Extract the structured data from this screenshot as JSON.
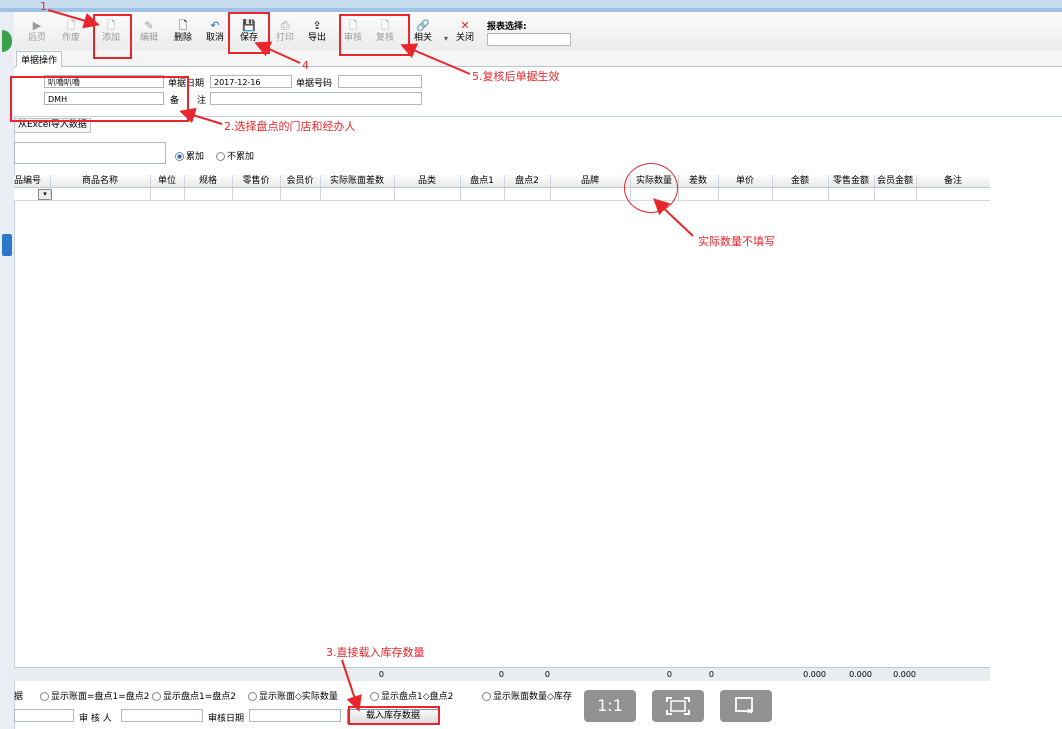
{
  "toolbar": {
    "buttons": [
      {
        "label": "后页",
        "icon": "play-icon",
        "enabled": false
      },
      {
        "label": "作废",
        "icon": "void-doc-icon",
        "enabled": false
      },
      {
        "label": "添加",
        "icon": "add-doc-icon",
        "enabled": false
      },
      {
        "label": "编辑",
        "icon": "edit-doc-icon",
        "enabled": false
      },
      {
        "label": "删除",
        "icon": "delete-doc-icon",
        "enabled": true
      },
      {
        "label": "取消",
        "icon": "undo-icon",
        "enabled": true
      },
      {
        "label": "保存",
        "icon": "save-icon",
        "enabled": true
      },
      {
        "label": "打印",
        "icon": "print-icon",
        "enabled": false
      },
      {
        "label": "导出",
        "icon": "export-icon",
        "enabled": true
      },
      {
        "label": "审核",
        "icon": "approve-icon",
        "enabled": false
      },
      {
        "label": "复核",
        "icon": "recheck-icon",
        "enabled": false
      },
      {
        "label": "相关",
        "icon": "link-icon",
        "enabled": true
      },
      {
        "label": "关闭",
        "icon": "close-icon",
        "enabled": true
      }
    ],
    "report_label": "报表选择:"
  },
  "tab": "单据操作",
  "form": {
    "store_value": "叭嚕叭嚕",
    "handler_value": "DMH",
    "date_label": "单据日期",
    "date_value": "2017-12-16",
    "number_label": "单据号码",
    "remark_label_a": "备",
    "remark_label_b": "注"
  },
  "import_tab": "从Excel导入数据",
  "mode": {
    "option1": "累加",
    "option2": "不累加",
    "selected": "累加"
  },
  "grid": {
    "headers": [
      "品编号",
      "商品名称",
      "单位",
      "规格",
      "零售价",
      "会员价",
      "实际账面差数",
      "品类",
      "盘点1",
      "盘点2",
      "品牌",
      "实际数量",
      "差数",
      "单价",
      "金额",
      "零售金额",
      "会员金额",
      "备注"
    ]
  },
  "footer": {
    "values": [
      "0",
      "0",
      "0",
      "0",
      "0",
      "0.000",
      "0.000",
      "0.000"
    ]
  },
  "options": [
    "据",
    "显示账面=盘点1=盘点2",
    "显示盘点1=盘点2",
    "显示账面◇实际数量",
    "显示盘点1◇盘点2",
    "显示账面数量◇库存"
  ],
  "bottom": {
    "reviewer_label": "审 核 人",
    "review_date_label": "审核日期",
    "load_button": "载入库存数据"
  },
  "annotations": {
    "a1": "1",
    "a2": "2.选择盘点的门店和经办人",
    "a3": "3.直接载入库存数量",
    "a4": "4",
    "a5": "5.复核后单据生效",
    "a6": "实际数量不填写"
  },
  "overlay": {
    "ratio": "1:1"
  },
  "colors": {
    "annotation": "#e8262b",
    "accent": "#2b63b9"
  }
}
